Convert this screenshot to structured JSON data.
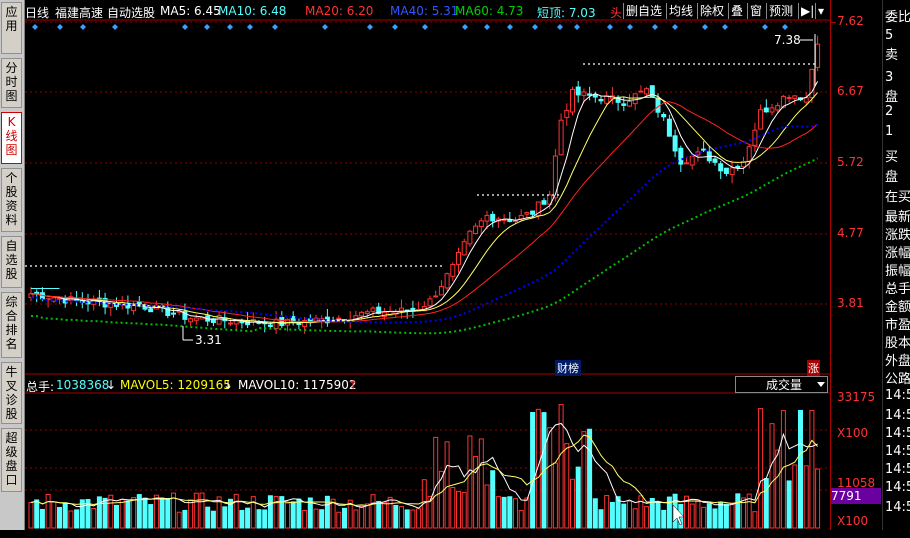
{
  "left_tabs": [
    {
      "label": "应用",
      "active": false
    },
    {
      "label": "分时图",
      "active": false
    },
    {
      "label": "K线图",
      "active": true
    },
    {
      "label": "个股资料",
      "active": false
    },
    {
      "label": "自选股",
      "active": false
    },
    {
      "label": "综合排名",
      "active": false
    },
    {
      "label": "牛叉诊股",
      "active": false
    },
    {
      "label": "超级盘口",
      "active": false
    }
  ],
  "header": {
    "period": "日线",
    "stock_name": "福建高速",
    "auto_pick": "自动选股",
    "ma5": "MA5: 6.45",
    "ma10": "MA10: 6.48",
    "ma20": "MA20: 6.20",
    "ma40": "MA40: 5.31",
    "ma60": "MA60: 4.73",
    "short_top": "短顶: 7.03",
    "short_top_trunc": "头"
  },
  "toolbar": [
    "删自选",
    "均线",
    "除权",
    "叠",
    "窗",
    "预测"
  ],
  "price_axis": [
    "7.62",
    "6.67",
    "5.72",
    "4.77",
    "3.81"
  ],
  "volume_axis": {
    "top": "33175",
    "x100a": "X100",
    "mid": "11058",
    "x100b": "X100",
    "current": "7791"
  },
  "volume_header": {
    "total_label": "总手:",
    "total_value": "1038368",
    "mavol5": "MAVOL5: 1209165",
    "mavol10": "MAVOL10: 1175902"
  },
  "volume_selector": "成交量",
  "annotations": {
    "high": "7.38",
    "low": "3.31",
    "caibang": "财榜",
    "zhang": "涨"
  },
  "right_panel": [
    "委比",
    "5",
    "卖",
    "3",
    "盘",
    "2",
    "1",
    "买",
    "盘",
    "在买",
    "最新",
    "涨跌",
    "涨幅",
    "振幅",
    "总手",
    "金额",
    "市盈",
    "股本",
    "外盘",
    "公路",
    "14:5",
    "14:5",
    "14:5",
    "14:5",
    "14:5",
    "14:5",
    "14:5"
  ],
  "colors": {
    "up": "#ff3232",
    "down": "#54ffff",
    "ma5": "#ffffff",
    "ma10": "#ffff00",
    "ma20": "#ff00ff",
    "ma40": "#0000ff",
    "ma60": "#00c000"
  }
}
